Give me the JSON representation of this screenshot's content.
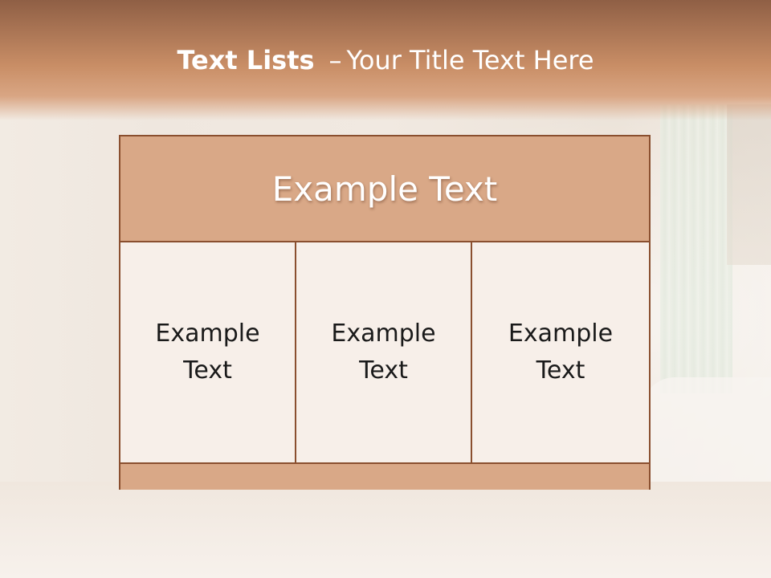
{
  "slide": {
    "title_bold": "Text Lists",
    "title_separator": "–",
    "title_rest": "Your Title Text Here"
  },
  "table": {
    "header": "Example Text",
    "cells": [
      {
        "line1": "Example",
        "line2": "Text"
      },
      {
        "line1": "Example",
        "line2": "Text"
      },
      {
        "line1": "Example",
        "line2": "Text"
      }
    ]
  },
  "colors": {
    "title_band": "#c98e66",
    "box_fill": "#d9a887",
    "box_border": "#8a4f2f",
    "cell_fill": "#f7efe9"
  }
}
